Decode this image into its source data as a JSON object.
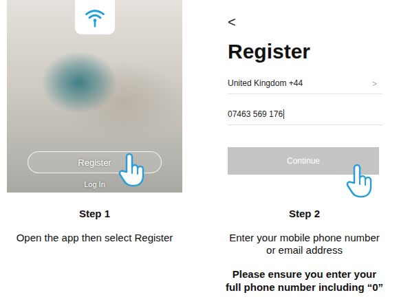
{
  "steps": [
    {
      "title": "Step 1",
      "caption": [
        "Open the app then select Register"
      ],
      "note": [],
      "screen": {
        "kind": "welcome",
        "primary_button": "Register",
        "link": "Log In"
      }
    },
    {
      "title": "Step 2",
      "caption": [
        "Enter your mobile phone number",
        "or email address"
      ],
      "note": [
        "Please ensure you enter your",
        "full phone number including “0”"
      ],
      "screen": {
        "kind": "register",
        "back": "<",
        "heading": "Register",
        "country": {
          "value": "United Kingdom +44",
          "chevron": ">"
        },
        "phone": {
          "value": "07463 569 176",
          "focused": true
        },
        "continue": {
          "label": "Continue",
          "disabled": true
        }
      }
    }
  ]
}
